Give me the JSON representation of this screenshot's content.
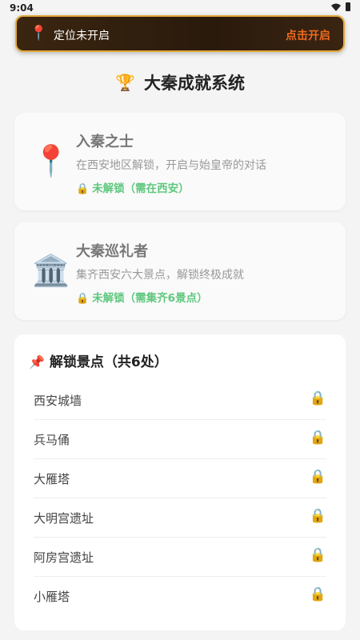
{
  "status_bar": {
    "time": "9:04"
  },
  "banner": {
    "text": "定位未开启",
    "action": "点击开启"
  },
  "page": {
    "title": "大秦成就系统"
  },
  "achievements": [
    {
      "title": "入秦之士",
      "description": "在西安地区解锁，开启与始皇帝的对话",
      "status": "未解锁（需在西安）"
    },
    {
      "title": "大秦巡礼者",
      "description": "集齐西安六大景点，解锁终极成就",
      "status": "未解锁（需集齐6景点）"
    }
  ],
  "spots": {
    "header": "解锁景点（共6处）",
    "items": [
      "西安城墙",
      "兵马俑",
      "大雁塔",
      "大明宫遗址",
      "阿房宫遗址",
      "小雁塔"
    ]
  }
}
